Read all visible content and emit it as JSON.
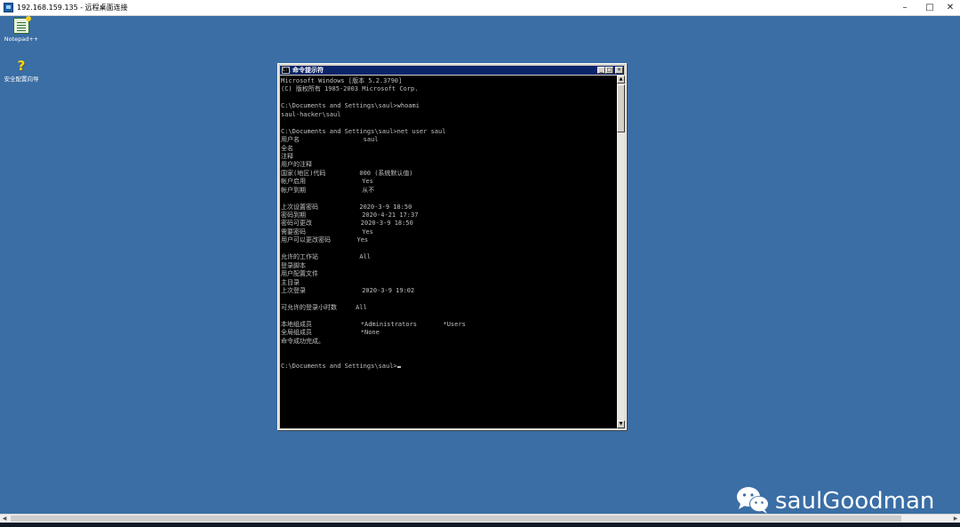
{
  "rdp_window": {
    "title": "192.168.159.135 - 远程桌面连接",
    "minimize": "–",
    "maximize": "□",
    "close": "✕"
  },
  "desktop": {
    "icons": [
      {
        "label": "Notepad++",
        "icon": "notepad-plus-plus-icon"
      },
      {
        "label": "安全配置向导",
        "icon": "security-config-wizard-icon"
      }
    ]
  },
  "cmd": {
    "title": "命令提示符",
    "icon_text": "C:\\",
    "buttons": {
      "minimize": "_",
      "maximize": "□",
      "close": "×"
    },
    "lines": [
      "Microsoft Windows [版本 5.2.3790]",
      "(C) 版权所有 1985-2003 Microsoft Corp.",
      "",
      "C:\\Documents and Settings\\saul>whoami",
      "saul-hacker\\saul",
      "",
      "C:\\Documents and Settings\\saul>net user saul",
      "用户名                 saul",
      "全名",
      "注释",
      "用户的注释",
      "国家(地区)代码         000 (系统默认值)",
      "帐户启用               Yes",
      "帐户到期               从不",
      "",
      "上次设置密码           2020-3-9 18:50",
      "密码到期               2020-4-21 17:37",
      "密码可更改             2020-3-9 18:50",
      "需要密码               Yes",
      "用户可以更改密码       Yes",
      "",
      "允许的工作站           All",
      "登录脚本",
      "用户配置文件",
      "主目录",
      "上次登录               2020-3-9 19:02",
      "",
      "可允许的登录小时数     All",
      "",
      "本地组成员             *Administrators       *Users",
      "全局组成员             *None",
      "命令成功完成。",
      "",
      "",
      "C:\\Documents and Settings\\saul>"
    ]
  },
  "watermark": {
    "text": "saulGoodman",
    "icon": "wechat-icon"
  },
  "colors": {
    "desktop": "#3a6ea5",
    "cmd_titlebar": "#0a246a",
    "console_bg": "#000000",
    "console_text": "#c0c0c0"
  }
}
